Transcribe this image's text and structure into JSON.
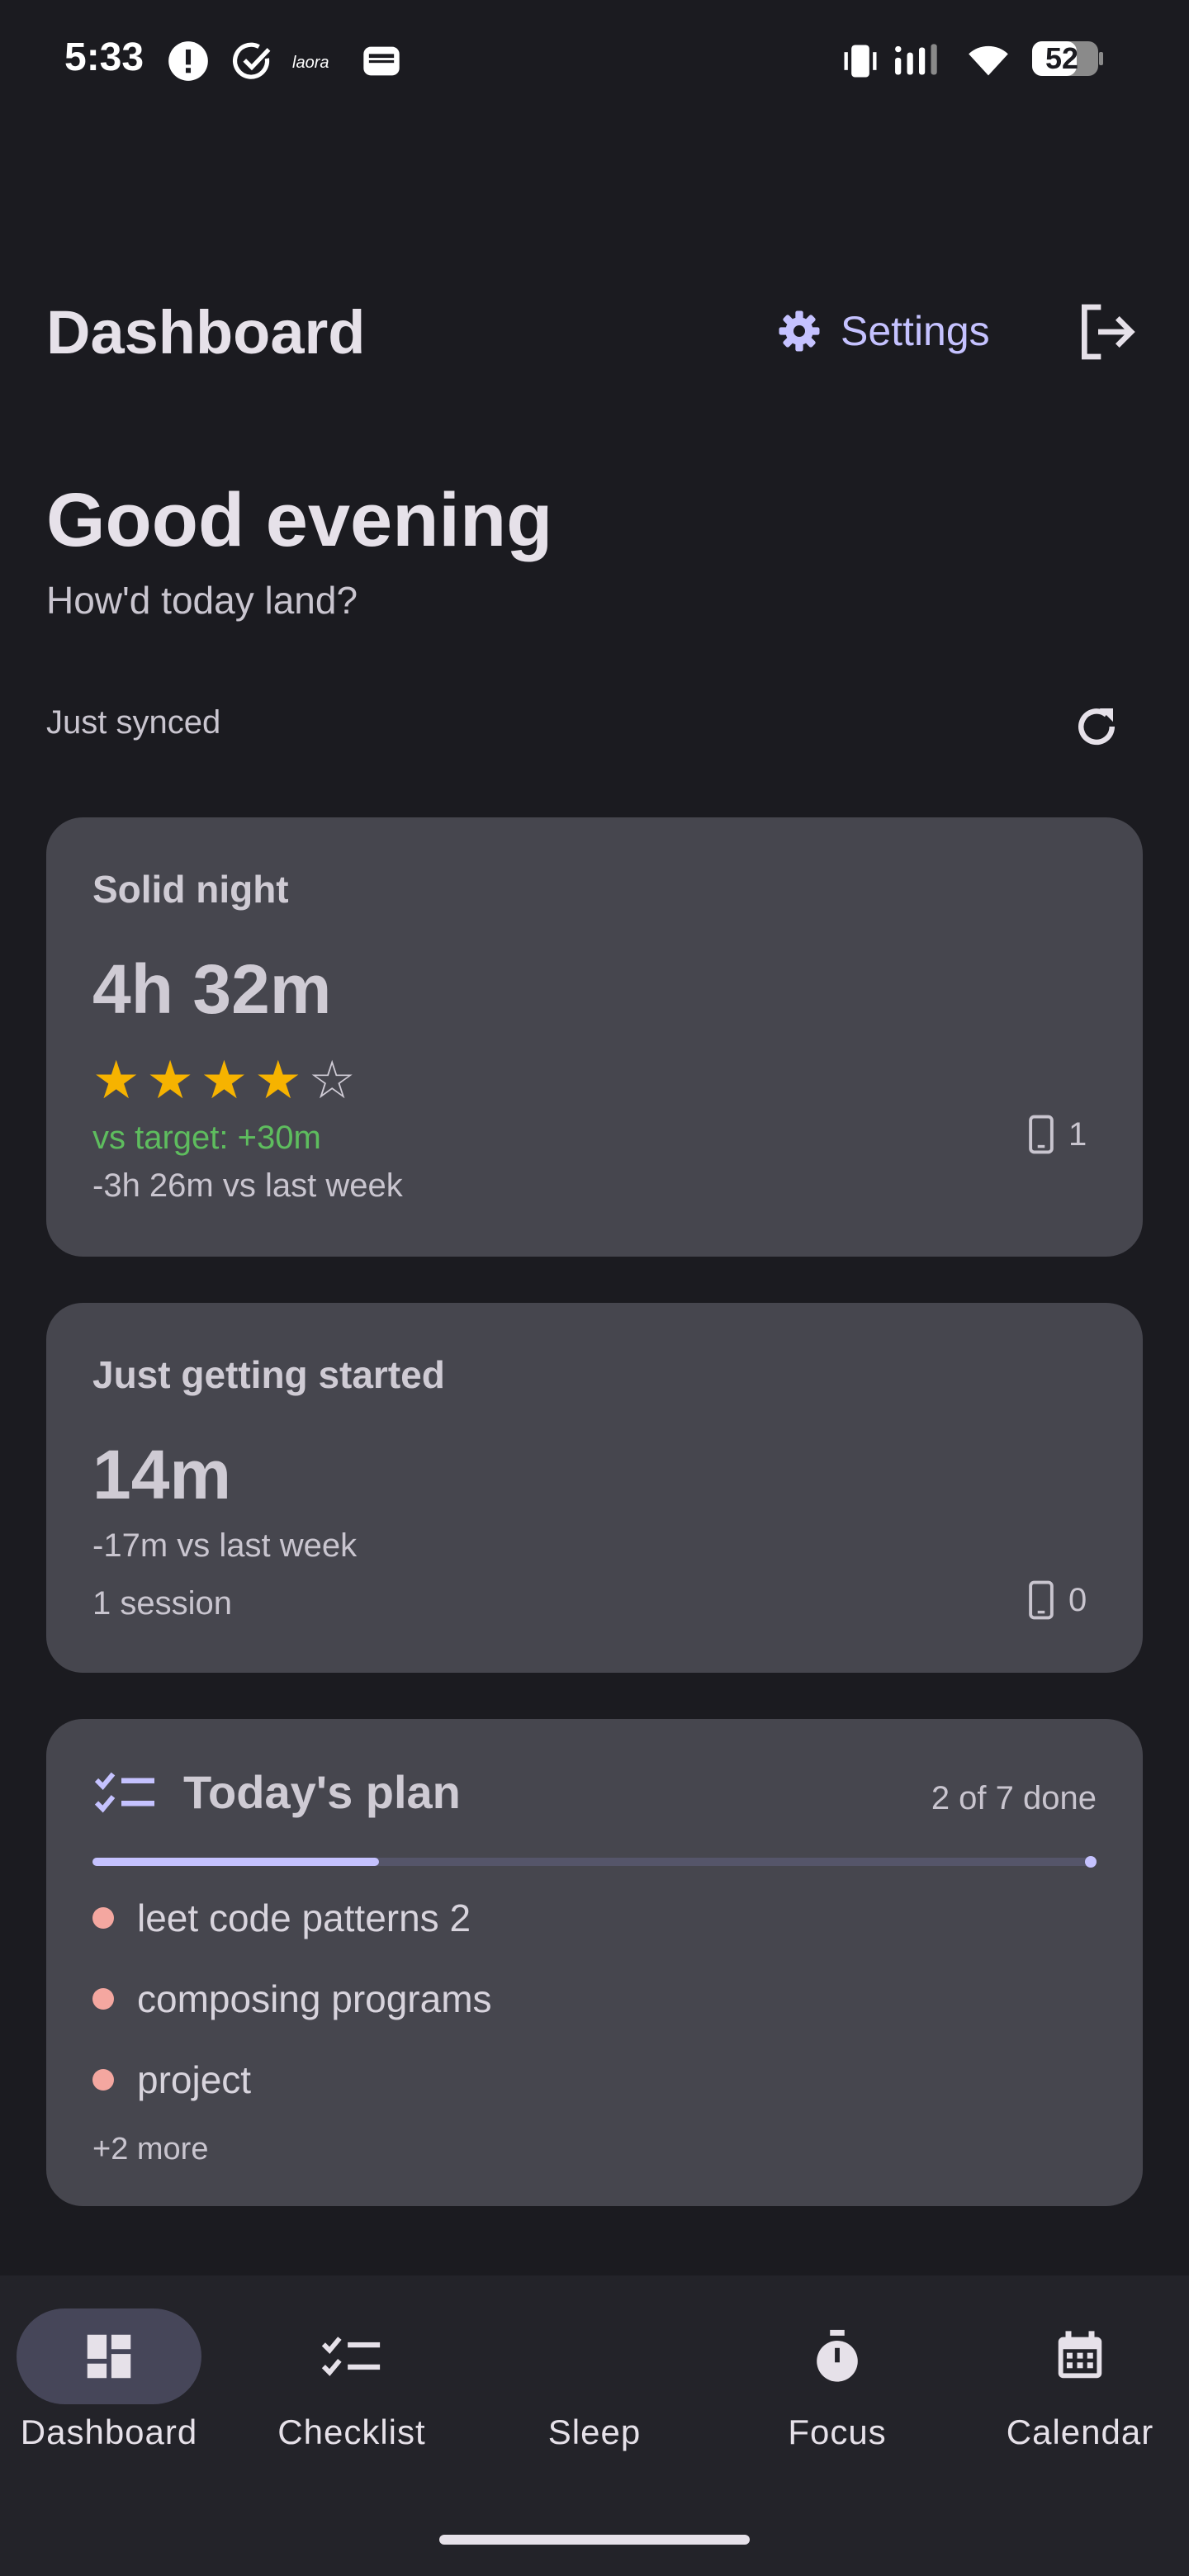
{
  "status_bar": {
    "time": "5:33",
    "battery": "52",
    "icons": [
      "alert-icon",
      "check-circle-icon",
      "app-logo-icon",
      "wallet-icon",
      "vibrate-icon",
      "signal-icon",
      "wifi-icon",
      "battery-icon"
    ]
  },
  "header": {
    "title": "Dashboard",
    "settings_label": "Settings",
    "logout_icon": "logout-icon"
  },
  "greeting": {
    "title": "Good evening",
    "subtitle": "How'd today land?"
  },
  "sync": {
    "status": "Just synced"
  },
  "sleep_card": {
    "title": "Solid night",
    "duration": "4h 32m",
    "rating": 4,
    "rating_max": 5,
    "vs_target": "vs target: +30m",
    "vs_last_week": "-3h 26m vs last week",
    "device_count": "1"
  },
  "focus_card": {
    "title": "Just getting started",
    "duration": "14m",
    "vs_last_week": "-17m vs last week",
    "sessions": "1 session",
    "device_count": "0"
  },
  "plan_card": {
    "title": "Today's plan",
    "progress_text": "2 of 7 done",
    "progress_fraction": 0.2857,
    "tasks": [
      {
        "label": "leet code patterns 2"
      },
      {
        "label": "composing programs"
      },
      {
        "label": "project"
      }
    ],
    "more": "+2 more"
  },
  "nav": {
    "items": [
      {
        "label": "Dashboard",
        "icon": "dashboard-icon",
        "active": true
      },
      {
        "label": "Checklist",
        "icon": "checklist-icon",
        "active": false
      },
      {
        "label": "Sleep",
        "icon": "moon-icon",
        "active": false
      },
      {
        "label": "Focus",
        "icon": "timer-icon",
        "active": false
      },
      {
        "label": "Calendar",
        "icon": "calendar-icon",
        "active": false
      }
    ]
  },
  "colors": {
    "background": "#1b1b20",
    "card": "#46464e",
    "accent": "#c5c2ff",
    "star": "#f6b300",
    "positive": "#5ebd5e",
    "task_dot": "#f4a7a0"
  }
}
